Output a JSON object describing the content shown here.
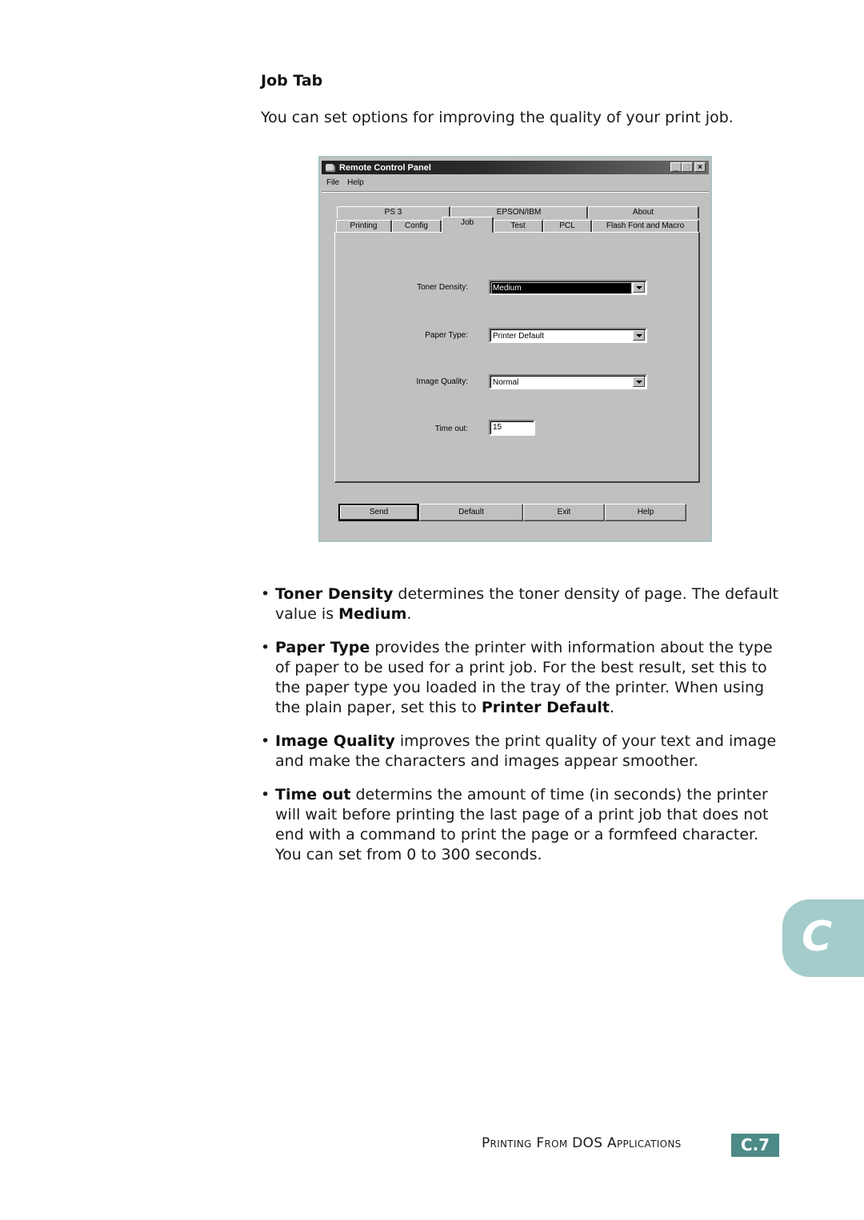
{
  "document": {
    "heading": "Job Tab",
    "intro": "You can set options for improving the quality of your print job."
  },
  "window": {
    "title": "Remote Control Panel",
    "title_icon": "printer-app-icon",
    "controls": {
      "minimize": "_",
      "maximize": "□",
      "close": "×"
    },
    "menu": [
      "File",
      "Help"
    ],
    "tabs_back_row": [
      "PS 3",
      "EPSON/IBM",
      "About"
    ],
    "tabs_front_row": [
      "Printing",
      "Config",
      "Job",
      "Test",
      "PCL",
      "Flash Font and Macro"
    ],
    "active_tab": "Job",
    "fields": {
      "toner_density": {
        "label": "Toner Density:",
        "value": "Medium"
      },
      "paper_type": {
        "label": "Paper Type:",
        "value": "Printer Default"
      },
      "image_quality": {
        "label": "Image Quality:",
        "value": "Normal"
      },
      "time_out": {
        "label": "Time out:",
        "value": "15"
      }
    },
    "buttons": [
      "Send",
      "Default",
      "Exit",
      "Help"
    ]
  },
  "bullets": [
    {
      "term": "Toner Density",
      "text": " determines the toner density of page. The default value is ",
      "term2": "Medium",
      "tail": "."
    },
    {
      "term": "Paper Type",
      "text": " provides the printer with information about the type of paper to be used for a print job. For the best result, set this to the paper type you loaded in the tray of the printer. When using the plain paper, set this to ",
      "term2": "Printer Default",
      "tail": "."
    },
    {
      "term": "Image Quality",
      "text": " improves the print quality of your text and image and make the characters and images appear smoother.",
      "term2": "",
      "tail": ""
    },
    {
      "term": "Time out",
      "text": " determins the amount of time (in seconds) the printer will wait before printing the last page of a print job that does not end with a command to print the page or a formfeed character. You can set from 0 to 300 seconds.",
      "term2": "",
      "tail": ""
    }
  ],
  "chapter_tab": {
    "letter": "C",
    "color": "#a3cccb"
  },
  "footer": {
    "section": "Printing From DOS Applications",
    "page": "C.7",
    "page_color": "#4b8a86"
  }
}
